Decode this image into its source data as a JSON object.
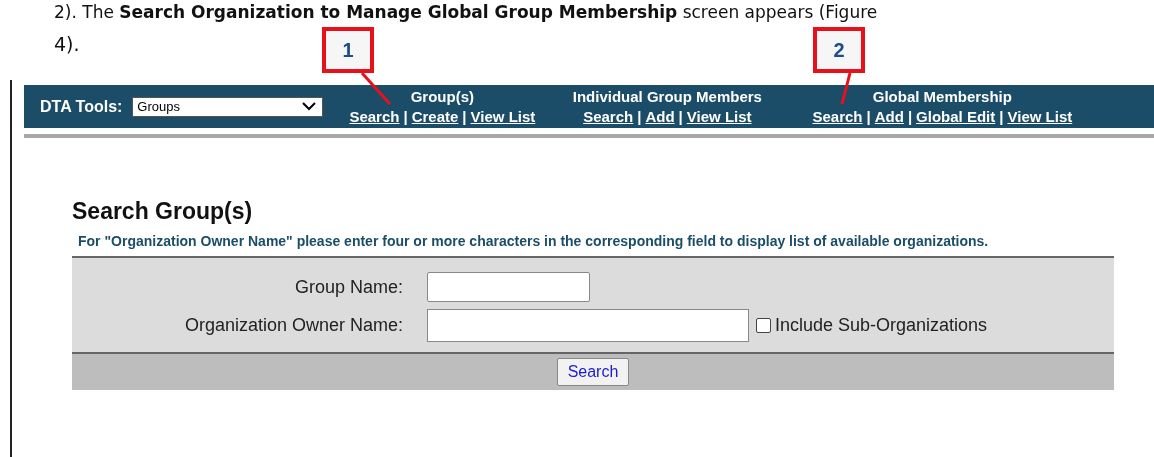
{
  "document": {
    "lines": [
      "2). The **Search Organization to Manage Global Group Membership** screen appears (Figure",
      "4)."
    ]
  },
  "callouts": [
    {
      "label": "1"
    },
    {
      "label": "2"
    }
  ],
  "navbar": {
    "label": "DTA Tools:",
    "select_value": "Groups",
    "separator": "|",
    "groups": [
      {
        "title": "Group(s)",
        "links": [
          "Search",
          "Create",
          "View List"
        ]
      },
      {
        "title": "Individual Group Members",
        "links": [
          "Search",
          "Add",
          "View List"
        ]
      },
      {
        "title": "Global Membership",
        "links": [
          "Search",
          "Add",
          "Global Edit",
          "View List"
        ]
      }
    ]
  },
  "heading": "Search Group(s)",
  "note": "For \"Organization Owner Name\" please enter four or more characters in the corresponding field to display list of available organizations.",
  "form": {
    "fields": [
      {
        "kind": "text",
        "label": "Group Name:"
      },
      {
        "kind": "text-with-checkbox",
        "label": "Organization Owner Name:",
        "checkbox_label": "Include Sub-Organizations",
        "checked": false
      }
    ],
    "button": "Search"
  }
}
